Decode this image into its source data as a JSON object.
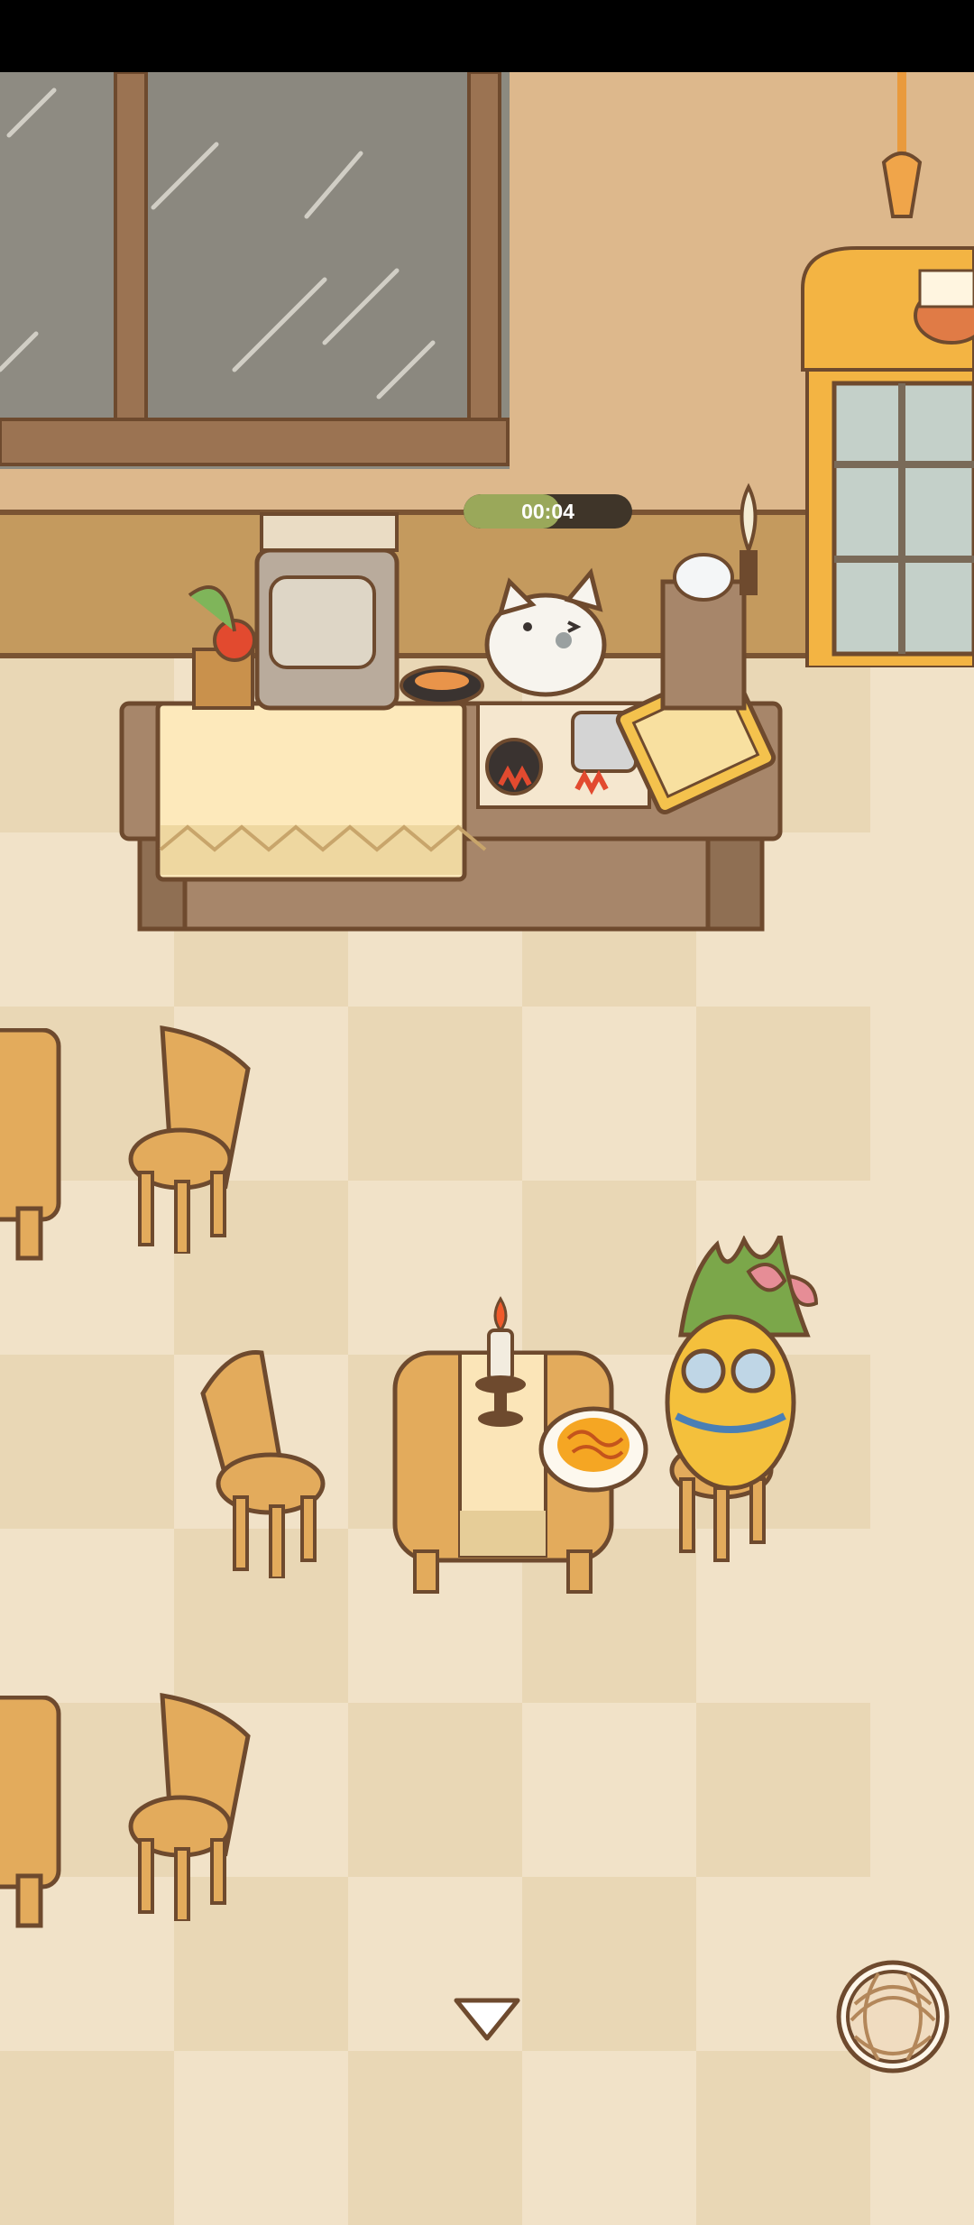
{
  "hud": {
    "timer_text": "00:04",
    "timer_progress": 0.57
  },
  "scene": {
    "colors": {
      "wall": "#ddb88c",
      "wood": "#c49a5e",
      "outline": "#6e4a2e",
      "floor_light": "#f1e2c8",
      "floor_dark": "#e9d7b5",
      "timer_fill": "#9aa85a"
    }
  },
  "controls": {
    "scroll_down_icon": "triangle-down-icon",
    "yarn_icon": "yarn-ball-icon"
  }
}
